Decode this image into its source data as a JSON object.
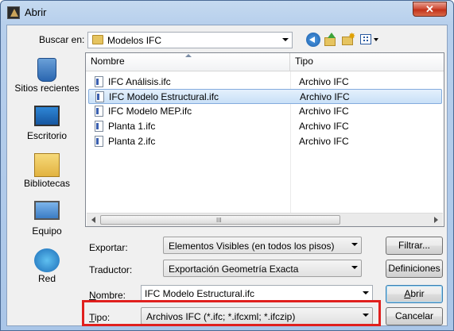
{
  "window": {
    "title": "Abrir",
    "close_label": "✕"
  },
  "toolbar": {
    "lookin_label": "Buscar en:",
    "lookin_value": "Modelos IFC"
  },
  "places": [
    {
      "label": "Sitios recientes",
      "icon": "recent-places-icon"
    },
    {
      "label": "Escritorio",
      "icon": "desktop-icon"
    },
    {
      "label": "Bibliotecas",
      "icon": "libraries-icon"
    },
    {
      "label": "Equipo",
      "icon": "computer-icon"
    },
    {
      "label": "Red",
      "icon": "network-icon"
    }
  ],
  "filelist": {
    "columns": [
      "Nombre",
      "Tipo"
    ],
    "rows": [
      {
        "name": "IFC Análisis.ifc",
        "type": "Archivo IFC",
        "selected": false
      },
      {
        "name": "IFC Modelo Estructural.ifc",
        "type": "Archivo IFC",
        "selected": true
      },
      {
        "name": "IFC Modelo MEP.ifc",
        "type": "Archivo IFC",
        "selected": false
      },
      {
        "name": "Planta 1.ifc",
        "type": "Archivo IFC",
        "selected": false
      },
      {
        "name": "Planta 2.ifc",
        "type": "Archivo IFC",
        "selected": false
      }
    ],
    "scroll_grip": "III"
  },
  "options": {
    "export_label": "Exportar:",
    "export_value": "Elementos Visibles (en todos los pisos)",
    "translator_label": "Traductor:",
    "translator_value": "Exportación Geometría Exacta",
    "filename_label_pre": "",
    "filename_label_u": "N",
    "filename_label_post": "ombre:",
    "filename_value": "IFC Modelo Estructural.ifc",
    "filetype_label_u": "T",
    "filetype_label_post": "ipo:",
    "filetype_value": "Archivos IFC (*.ifc; *.ifcxml; *.ifczip)"
  },
  "buttons": {
    "filter": "Filtrar...",
    "definitions": "Definiciones",
    "open_u": "A",
    "open_post": "brir",
    "cancel": "Cancelar"
  },
  "colors": {
    "highlight": "#e0201e",
    "selection": "#c9e0f7"
  }
}
